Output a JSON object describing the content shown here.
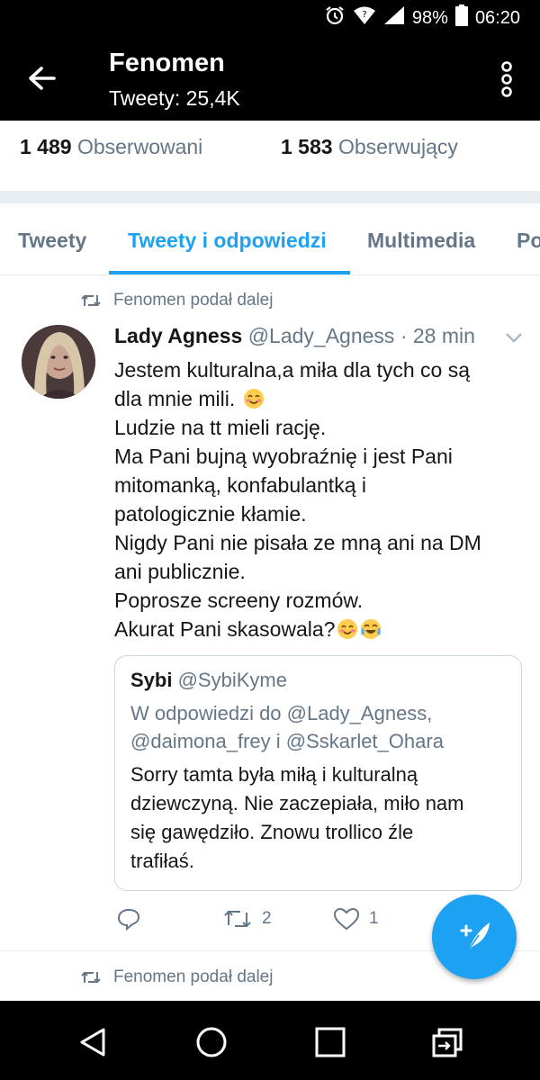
{
  "status_bar": {
    "battery": "98%",
    "time": "06:20",
    "icons": [
      "alarm-icon",
      "wifi-icon",
      "signal-icon",
      "battery-icon"
    ]
  },
  "header": {
    "title": "Fenomen",
    "subtitle": "Tweety: 25,4K",
    "icons": [
      "back-arrow-icon",
      "more-vert-icon"
    ]
  },
  "stats": {
    "following_count": "1 489",
    "following_label": "Obserwowani",
    "followers_count": "1 583",
    "followers_label": "Obserwujący"
  },
  "tabs": [
    {
      "label": "Tweety",
      "active": false
    },
    {
      "label": "Tweety i odpowiedzi",
      "active": true
    },
    {
      "label": "Multimedia",
      "active": false
    },
    {
      "label": "Po",
      "active": false
    }
  ],
  "tweet": {
    "retweet_label": "Fenomen podał dalej",
    "name": "Lady Agness",
    "handle": "@Lady_Agness",
    "time": "· 28 min",
    "lines": [
      "Jestem kulturalna,a miła dla tych co są",
      "dla mnie mili.",
      "Ludzie na tt mieli rację.",
      "Ma Pani bujną wyobraźnię i jest Pani",
      "mitomanką, konfabulantką i",
      "patologicznie kłamie.",
      "Nigdy Pani nie pisała ze mną ani na DM",
      "ani publicznie.",
      "Poprosze screeny rozmów.",
      "Akurat Pani skasowala?"
    ],
    "quote": {
      "name": "Sybi",
      "handle": "@SybiKyme",
      "reply_lines": [
        "W odpowiedzi do @Lady_Agness,",
        "@daimona_frey i @Sskarlet_Ohara"
      ],
      "text_lines": [
        "Sorry tamta była miłą i kulturalną",
        "dziewczyną. Nie zaczepiała, miło nam",
        "się gawędziło. Znowu trollico źle",
        "trafiłaś."
      ]
    },
    "actions": {
      "reply_count": "",
      "retweet_count": "2",
      "like_count": "1"
    }
  },
  "next_retweet_label": "Fenomen podał dalej",
  "colors": {
    "accent": "#1da1f2",
    "secondary_text": "#657786",
    "bar_background": "#000000"
  }
}
